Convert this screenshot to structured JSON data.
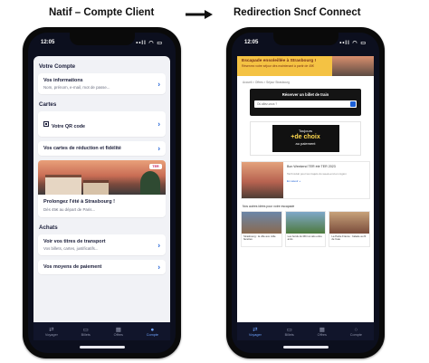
{
  "headings": {
    "left": "Natif – Compte Client",
    "right": "Redirection Sncf Connect"
  },
  "status_bar": {
    "time": "12:05",
    "icons": "••ll ◠ ▭"
  },
  "left_app": {
    "section_account": "Votre Compte",
    "info_card": {
      "title": "Vos informations",
      "subtitle": "Nom, prénom, e-mail, mot de passe..."
    },
    "section_cards": "Cartes",
    "qr_card": {
      "title": "Votre QR code"
    },
    "discount_card": {
      "title": "Vos cartes de réduction et fidélité"
    },
    "promo": {
      "logo": "TER",
      "title": "Prolongez l'été à Strasbourg !",
      "subtitle": "Dès 45€ au départ de Paris..."
    },
    "section_purchases": "Achats",
    "tickets_card": {
      "title": "Voir vos titres de transport",
      "subtitle": "Vos billets, cartes, justificatifs..."
    },
    "payment_card": {
      "title": "Vos moyens de paiement"
    },
    "tabs": [
      {
        "label": "Voyager",
        "icon": "⇄"
      },
      {
        "label": "Billets",
        "icon": "▭"
      },
      {
        "label": "Offres",
        "icon": "▦"
      },
      {
        "label": "Compte",
        "icon": "●"
      }
    ]
  },
  "right_web": {
    "banner": {
      "title": "Escapade ensoleillée à Strasbourg !",
      "subtitle": "Réservez votre séjour dès maintenant à partir de 45€"
    },
    "breadcrumb": "Accueil > Offres > Séjour Strasbourg",
    "search": {
      "title": "Réserver un billet de train",
      "placeholder": "Où allez-vous ?"
    },
    "ad": {
      "line1": "Toujours",
      "big": "+de choix",
      "line2": "au paiement"
    },
    "article": {
      "title": "Bon Weekend TER été TER 2023",
      "desc": "Tarif réduit pour les trajets du week-end en région",
      "link": "En savoir +"
    },
    "ideas_title": "Nos autres idées pour votre escapade",
    "ideas": [
      {
        "title": "Strasbourg : la ville aux mille facettes"
      },
      {
        "title": "Les bords du Rhin à vélo entre amis"
      },
      {
        "title": "La Petite France : balade au fil de l'eau"
      }
    ],
    "tabs": [
      {
        "label": "Voyager",
        "icon": "⇄"
      },
      {
        "label": "Billets",
        "icon": "▭"
      },
      {
        "label": "Offres",
        "icon": "▦"
      },
      {
        "label": "Compte",
        "icon": "○"
      }
    ]
  }
}
